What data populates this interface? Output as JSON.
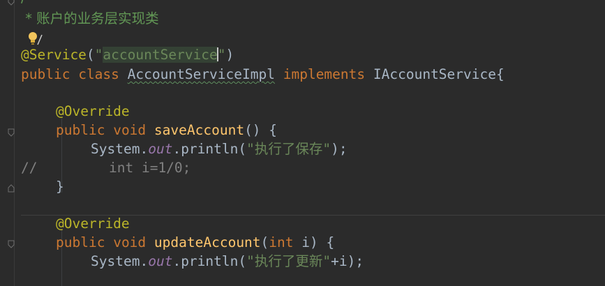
{
  "editor": {
    "comment_top": "/**",
    "comment_star": " * ",
    "comment_text": "账户的业务层实现类",
    "annotation_service": "@Service",
    "service_paren_open": "(",
    "service_quote_open": "\"",
    "service_value": "accountService",
    "service_quote_close": "\"",
    "service_paren_close": ")",
    "kw_public": "public",
    "kw_class": "class",
    "class_name": "AccountServiceImpl",
    "kw_implements": "implements",
    "interface_name": "IAccountService",
    "brace_open": "{",
    "annotation_override": "@Override",
    "kw_void": "void",
    "method_save": "saveAccount",
    "method_save_sig": "() {",
    "system": "System",
    "dot": ".",
    "out": "out",
    "println": "println",
    "save_string": "\"执行了保存\"",
    "stmt_end": ");",
    "comment_marker": "//",
    "commented_code": "int i=1/0;",
    "brace_close": "}",
    "method_update": "updateAccount",
    "update_paren_open": "(",
    "kw_int": "int",
    "update_param": " i) {",
    "update_string": "\"执行了更新\"",
    "update_concat": "+i);"
  }
}
